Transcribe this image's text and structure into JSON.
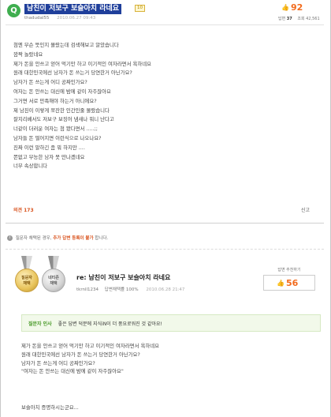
{
  "question": {
    "badge": "Q",
    "title": "남친이 저보구 보슬아치 라네요",
    "level_badge": "10",
    "author": "thadudal55",
    "date": "2010.06.27 09:43",
    "score": "92",
    "answers_label": "답변",
    "answers_count": "37",
    "views_label": "조회",
    "views_count": "42,561",
    "body_lines": [
      "첨엔 무슨 뜻인지 몰랐는데 검색해보고 알았습니다",
      "깜짝 놀랐네요",
      "제가 돈을 안쓰고 얻어 먹기만 하고 이기적인 여자라면서 욕하네요",
      "원래 대한민국에선 남자가 돈 쓰는거 당연한거 아닌가요?",
      "남자가 돈 쓰는게 어디 공짜인가요?",
      "여자는 돈 안쓰는 대신에 밤에 같이 자주잖아요",
      "그거면 서로 만족해야 하는거 아니에요?",
      "제 남친이 이렇게 쪼잔한 인간인줄 몰랐습니다",
      "잘지리베서도 저보구 보징어 냄새나 뭐니 난다고",
      "너같이 더러운 여자는 첨 봤다면서 .....;;",
      "남자들 돈 떨어지면 이런식으로 나오나요?",
      "진짜 이런 말하긴 좀 뭐 하지만 ....",
      "쫀없고 무능한 남자 못 만나겠네요",
      "너무 속상합니다"
    ],
    "opinion_label": "의견 173",
    "report_label": "신고"
  },
  "notice": {
    "info": "i",
    "text_before": "질문자 채택된 경우,",
    "link_text": "추가 답변 등록이 불가",
    "text_after": "합니다."
  },
  "answer": {
    "medal_gold": "질문자\n채택",
    "medal_silver": "네티즌\n채택",
    "title": "re: 남친이 저보구 보슬아치 라네요",
    "author": "tkrnll1234",
    "accept_rate": "답변채택률 100%",
    "date": "2010.06.28 21:47",
    "recommend_label": "답변 추천하기",
    "recommend_count": "56",
    "thanks_label": "질문자 인사",
    "thanks_text": "좋은 답변 덕분에 지식iN이 더 풍요로워진 것 같아요!",
    "body_lines": [
      "제가 돈을 안쓰고 얻어 먹기만 하고 이기적인 여자라면서 욕하네요",
      "원래 대한민국에선 남자가 돈 쓰는거 당연한거 아닌가요?",
      "남자가 돈 쓰는게 어디 공짜인가요?",
      "\"여자는 돈 안쓰는 대신에 밤에 같이 자주잖아요\""
    ],
    "tail": "보슬아치 증명하시는군요..."
  },
  "colors": {
    "title_bg": "#1f3f9b",
    "accent_orange": "#f26b1d",
    "badge_green": "#3fae4f",
    "thanks_green": "#4a9a2a"
  }
}
